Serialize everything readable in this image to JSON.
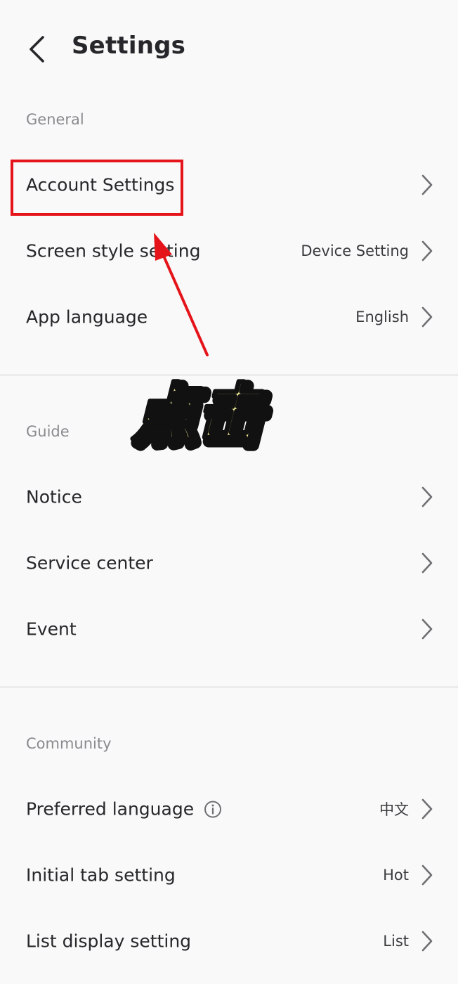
{
  "header": {
    "title": "Settings"
  },
  "sections": {
    "general": {
      "label": "General",
      "items": [
        {
          "label": "Account Settings",
          "value": ""
        },
        {
          "label": "Screen style setting",
          "value": "Device Setting"
        },
        {
          "label": "App language",
          "value": "English"
        }
      ]
    },
    "guide": {
      "label": "Guide",
      "items": [
        {
          "label": "Notice",
          "value": ""
        },
        {
          "label": "Service center",
          "value": ""
        },
        {
          "label": "Event",
          "value": ""
        }
      ]
    },
    "community": {
      "label": "Community",
      "items": [
        {
          "label": "Preferred language",
          "value": "中文"
        },
        {
          "label": "Initial tab setting",
          "value": "Hot"
        },
        {
          "label": "List display setting",
          "value": "List"
        }
      ]
    }
  },
  "annotation": {
    "text": "点击",
    "highlight_color": "#e5141b",
    "text_fill": "#fbf59a",
    "text_stroke": "#111111"
  },
  "icons": {
    "back": "chevron-left-icon",
    "row_arrow": "chevron-right-icon",
    "info": "info-circle-icon"
  }
}
